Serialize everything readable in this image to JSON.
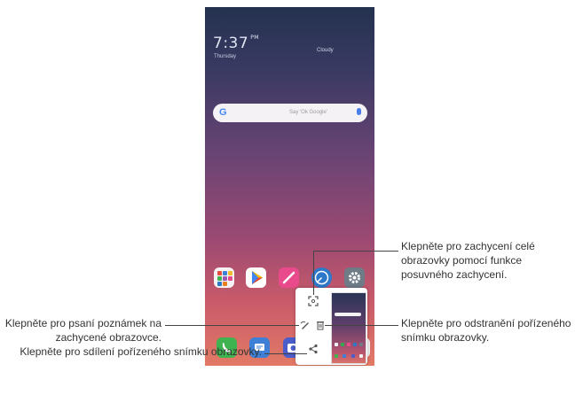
{
  "home": {
    "clock": "7:37",
    "ampm": "PM",
    "date": "Thursday",
    "weather": "Cloudy",
    "search_placeholder": "Say 'Ok Google'",
    "g_letter": "G"
  },
  "callouts": {
    "capture_full": "Klepněte pro zachycení celé obrazovky pomocí funkce posuvného zachycení.",
    "write_notes": "Klepněte pro psaní poznámek na zachycené obrazovce.",
    "delete_shot": "Klepněte pro odstranění pořízeného snímku obrazovky.",
    "share_shot": "Klepněte pro sdílení pořízeného snímku obrazovky."
  },
  "icons": {
    "expand": "expand-capture-icon",
    "edit": "edit-capture-icon",
    "delete": "trash-icon",
    "share": "share-icon"
  },
  "colors": {
    "wallpaper_top": "#24314f",
    "wallpaper_bottom": "#e27a65"
  }
}
